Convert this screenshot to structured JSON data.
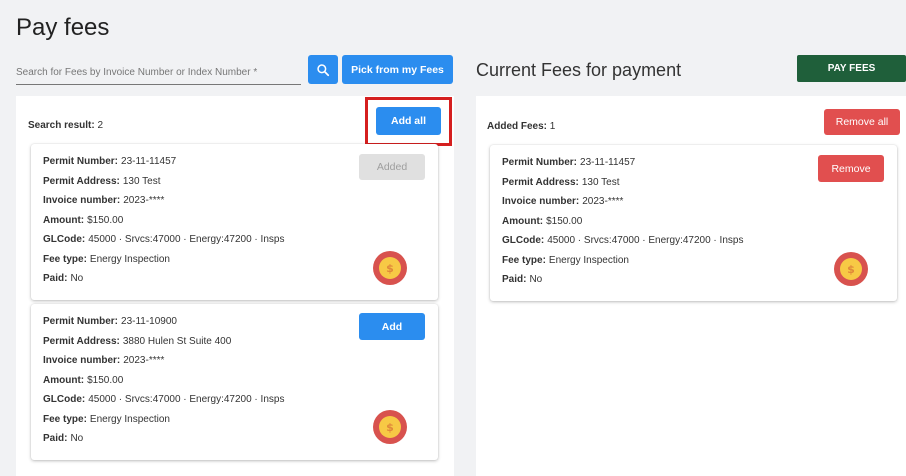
{
  "page": {
    "title": "Pay fees"
  },
  "search": {
    "placeholder": "Search for Fees by Invoice Number or Index Number *",
    "pick_label": "Pick from my Fees"
  },
  "current": {
    "title": "Current Fees for payment",
    "pay_label": "PAY FEES"
  },
  "results": {
    "label": "Search result:",
    "count": "2",
    "add_all_label": "Add all",
    "cards": [
      {
        "permit_number_label": "Permit Number:",
        "permit_number": "23-11-11457",
        "permit_address_label": "Permit Address:",
        "permit_address": "130 Test",
        "invoice_label": "Invoice number:",
        "invoice": "2023-****",
        "amount_label": "Amount:",
        "amount": "$150.00",
        "glcode_label": "GLCode:",
        "glcode": "45000 · Srvcs:47000 · Energy:47200 · Insps",
        "fee_type_label": "Fee type:",
        "fee_type": "Energy Inspection",
        "paid_label": "Paid:",
        "paid": "No",
        "action_label": "Added",
        "action_state": "disabled"
      },
      {
        "permit_number_label": "Permit Number:",
        "permit_number": "23-11-10900",
        "permit_address_label": "Permit Address:",
        "permit_address": "3880 Hulen St Suite 400",
        "invoice_label": "Invoice number:",
        "invoice": "2023-****",
        "amount_label": "Amount:",
        "amount": "$150.00",
        "glcode_label": "GLCode:",
        "glcode": "45000 · Srvcs:47000 · Energy:47200 · Insps",
        "fee_type_label": "Fee type:",
        "fee_type": "Energy Inspection",
        "paid_label": "Paid:",
        "paid": "No",
        "action_label": "Add",
        "action_state": "enabled"
      }
    ]
  },
  "added": {
    "label": "Added Fees:",
    "count": "1",
    "remove_all_label": "Remove all",
    "cards": [
      {
        "permit_number_label": "Permit Number:",
        "permit_number": "23-11-11457",
        "permit_address_label": "Permit Address:",
        "permit_address": "130 Test",
        "invoice_label": "Invoice number:",
        "invoice": "2023-****",
        "amount_label": "Amount:",
        "amount": "$150.00",
        "glcode_label": "GLCode:",
        "glcode": "45000 · Srvcs:47000 · Energy:47200 · Insps",
        "fee_type_label": "Fee type:",
        "fee_type": "Energy Inspection",
        "paid_label": "Paid:",
        "paid": "No",
        "action_label": "Remove"
      }
    ]
  },
  "icons": {
    "coin": "dollar-coin-icon",
    "search": "search-icon",
    "coin_symbol": "$"
  },
  "colors": {
    "primary": "#2b8def",
    "danger": "#e14f4f",
    "pay": "#1f5f3a",
    "highlight": "#d51f1f"
  }
}
